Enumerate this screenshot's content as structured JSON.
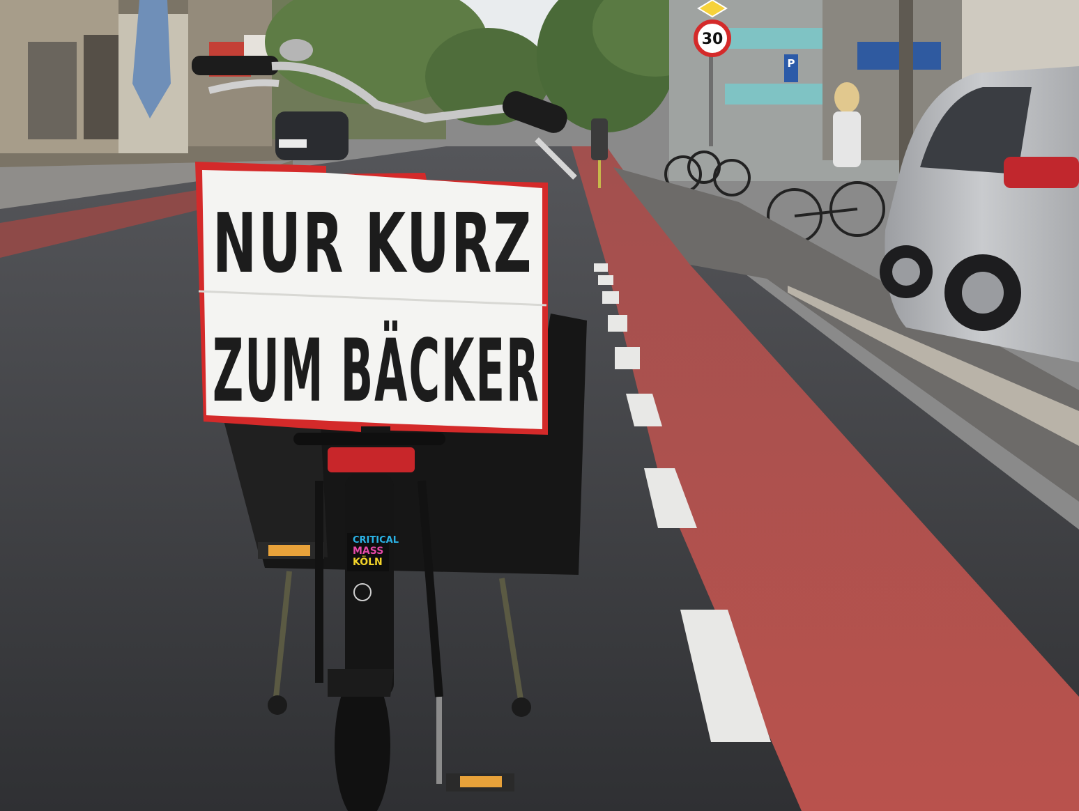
{
  "sign": {
    "line1": "NUR KURZ",
    "line2": "ZUM BÄCKER"
  },
  "sticker": {
    "line1": "CRITICAL",
    "line2": "MASS",
    "line3": "KÖLN"
  },
  "speed_sign": {
    "value": "30"
  },
  "parking_sign": {
    "letter": "P"
  },
  "colors": {
    "asphalt": "#3f4043",
    "bike_lane": "#b5504c",
    "sign_border": "#d42a2a",
    "sign_face": "#f4f4f2",
    "car": "#b9bbbe",
    "foliage": "#5d7a45",
    "sky": "#e9ecee"
  }
}
